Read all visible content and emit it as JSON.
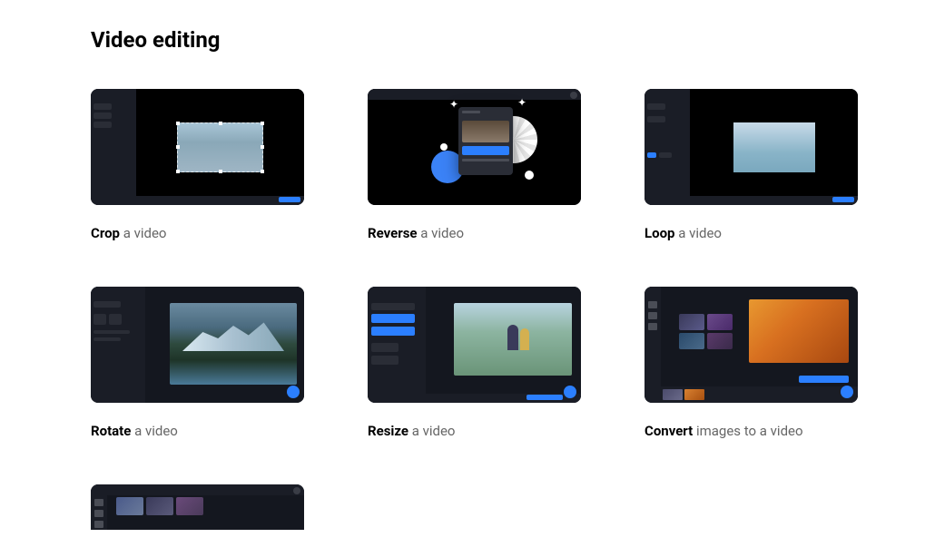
{
  "section_title": "Video editing",
  "cards": [
    {
      "strong": "Crop",
      "rest": " a video",
      "name": "crop"
    },
    {
      "strong": "Reverse",
      "rest": " a video",
      "name": "reverse"
    },
    {
      "strong": "Loop",
      "rest": " a video",
      "name": "loop"
    },
    {
      "strong": "Rotate",
      "rest": " a video",
      "name": "rotate"
    },
    {
      "strong": "Resize",
      "rest": " a video",
      "name": "resize"
    },
    {
      "strong": "Convert",
      "rest": " images to a video",
      "name": "convert"
    }
  ]
}
